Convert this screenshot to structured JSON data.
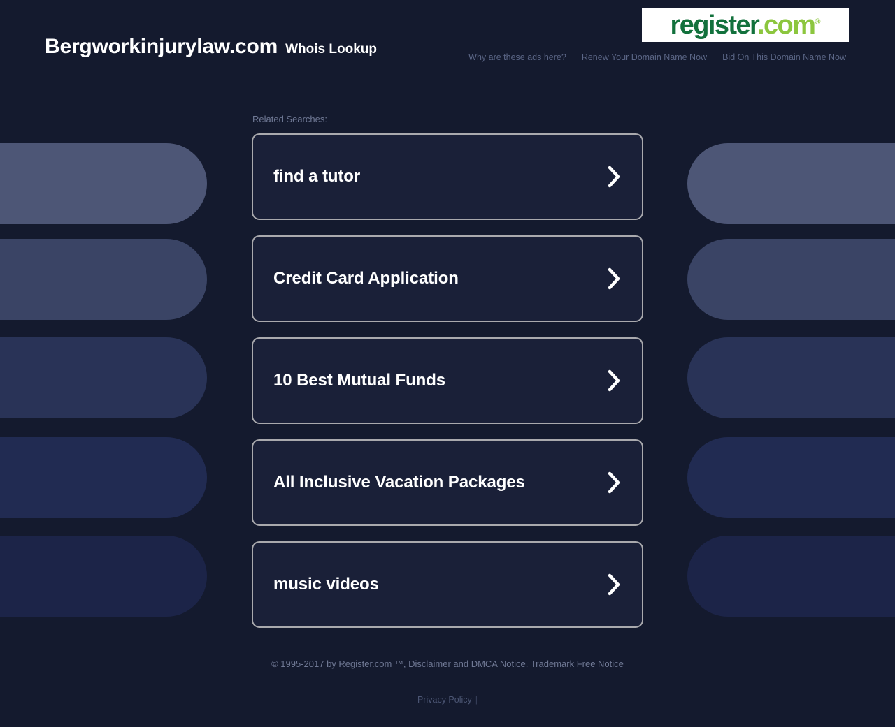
{
  "page": {
    "background_color": "#141a2e"
  },
  "header": {
    "domain_title": "Bergworkinjurylaw.com",
    "whois_label": "Whois Lookup",
    "logo": {
      "part_dark": "register",
      "part_light": ".com",
      "registered_mark": "®",
      "color_dark": "#12713c",
      "color_light": "#8cc63e",
      "background": "#ffffff"
    },
    "ad_links": [
      {
        "label": "Why are these ads here?"
      },
      {
        "label": "Renew Your Domain Name Now"
      },
      {
        "label": "Bid On This Domain Name Now"
      }
    ]
  },
  "main": {
    "related_label": "Related Searches:",
    "cards": [
      {
        "label": "find a tutor"
      },
      {
        "label": "Credit Card Application"
      },
      {
        "label": "10 Best Mutual Funds"
      },
      {
        "label": "All Inclusive Vacation Packages"
      },
      {
        "label": "music videos"
      }
    ]
  },
  "decor": {
    "pill_colors": [
      "#4d5676",
      "#3a4465",
      "#293357",
      "#212b52",
      "#1c2448"
    ]
  },
  "footer": {
    "copyright": "© 1995-2017 by Register.com ™, Disclaimer and DMCA Notice. Trademark Free Notice",
    "privacy_label": "Privacy Policy",
    "privacy_separator": "|"
  }
}
